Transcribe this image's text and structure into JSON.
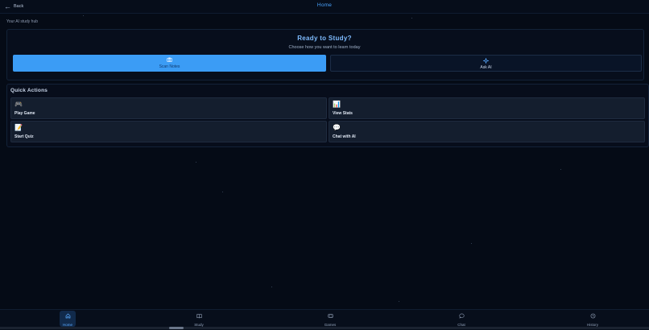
{
  "header": {
    "back_label": "Back",
    "title": "Home"
  },
  "subtitle": "Your AI study hub",
  "hero": {
    "title": "Ready to Study?",
    "subtitle": "Choose how you want to learn today",
    "primary_button": {
      "label": "Scan Notes",
      "icon": "camera-icon"
    },
    "secondary_button": {
      "label": "Ask AI",
      "icon": "sparkle-icon"
    }
  },
  "quick_actions": {
    "title": "Quick Actions",
    "items": [
      {
        "label": "Play Game",
        "icon": "🎮"
      },
      {
        "label": "View Stats",
        "icon": "📊"
      },
      {
        "label": "Start Quiz",
        "icon": "📝"
      },
      {
        "label": "Chat with AI",
        "icon": "💬"
      }
    ]
  },
  "nav": [
    {
      "label": "Home",
      "icon": "home-icon",
      "active": true
    },
    {
      "label": "Study",
      "icon": "book-icon"
    },
    {
      "label": "Games",
      "icon": "gamepad-icon"
    },
    {
      "label": "Chat",
      "icon": "chat-icon"
    },
    {
      "label": "History",
      "icon": "history-icon"
    }
  ],
  "colors": {
    "accent": "#3b9cf5",
    "title": "#4aa3ff",
    "background": "#050b16"
  }
}
